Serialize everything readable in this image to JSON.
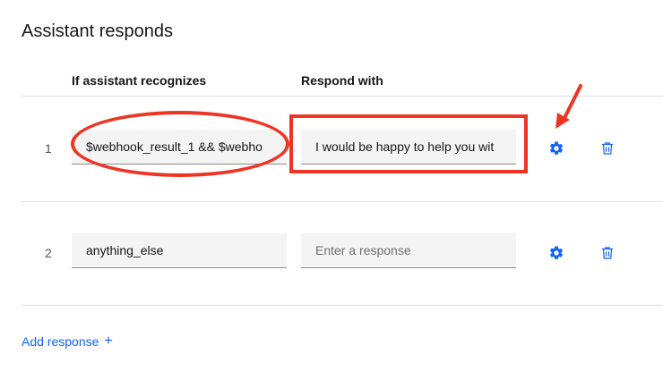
{
  "section": {
    "title": "Assistant responds"
  },
  "table": {
    "headers": {
      "condition": "If assistant recognizes",
      "response": "Respond with"
    },
    "rows": [
      {
        "number": "1",
        "condition": "$webhook_result_1 && $webho",
        "response": "I would be happy to help you wit"
      },
      {
        "number": "2",
        "condition": "anything_else",
        "response_placeholder": "Enter a response"
      }
    ]
  },
  "actions": {
    "add_response": "Add response",
    "add_icon": "+"
  },
  "icons": {
    "settings": "gear-icon",
    "delete": "trash-icon"
  },
  "colors": {
    "accent": "#0f62fe",
    "annotation": "#ee3524",
    "field_bg": "#f4f4f4",
    "divider": "#e0e0e0"
  }
}
